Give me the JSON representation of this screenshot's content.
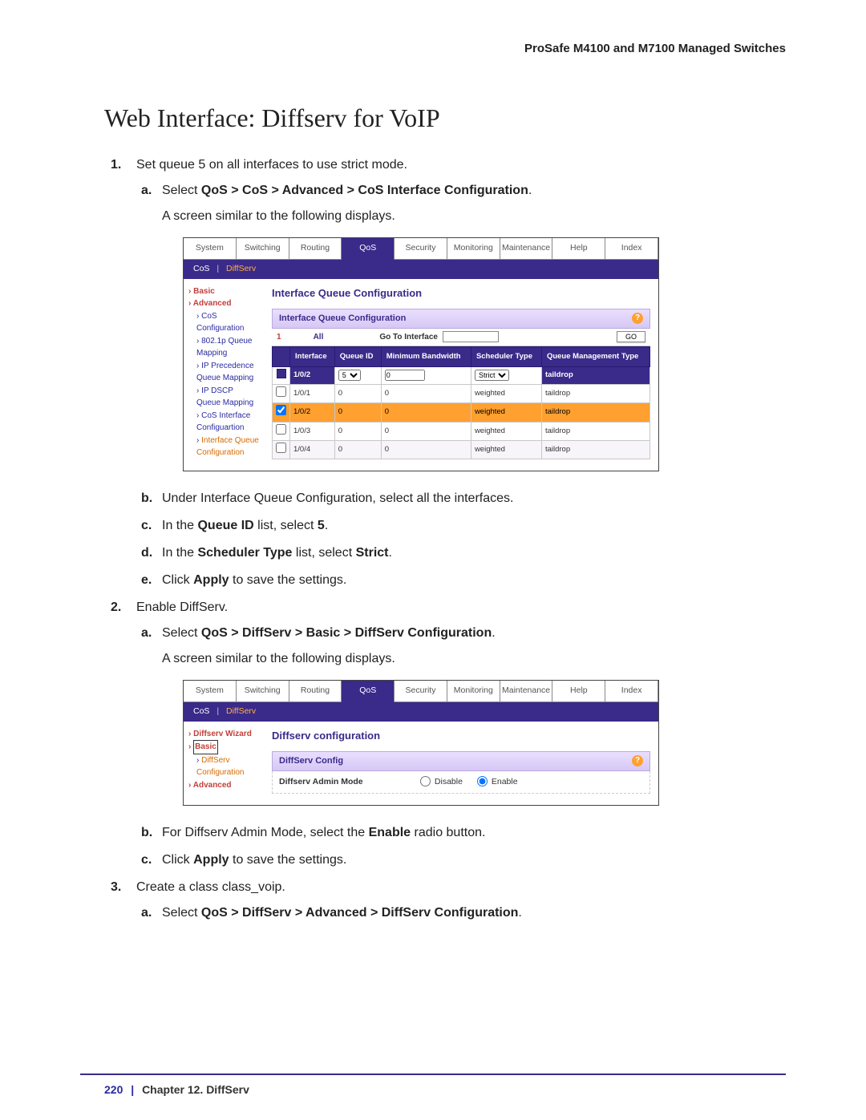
{
  "doc_header": "ProSafe M4100 and M7100 Managed Switches",
  "page_title": "Web Interface: Diffserv for VoIP",
  "steps": {
    "s1": {
      "num": "1.",
      "text": "Set queue 5 on all interfaces to use strict mode.",
      "a_num": "a.",
      "a_pre": "Select ",
      "a_bold": "QoS > CoS > Advanced > CoS Interface Configuration",
      "a_post": ".",
      "a_after": "A screen similar to the following displays.",
      "b_num": "b.",
      "b_text": "Under Interface Queue Configuration, select all the interfaces.",
      "c_num": "c.",
      "c_pre": "In the ",
      "c_bold": "Queue ID",
      "c_mid": " list, select ",
      "c_bold2": "5",
      "c_post": ".",
      "d_num": "d.",
      "d_pre": "In the ",
      "d_bold": "Scheduler Type",
      "d_mid": " list, select ",
      "d_bold2": "Strict",
      "d_post": ".",
      "e_num": "e.",
      "e_pre": "Click ",
      "e_bold": "Apply",
      "e_post": " to save the settings."
    },
    "s2": {
      "num": "2.",
      "text": "Enable DiffServ.",
      "a_num": "a.",
      "a_pre": "Select ",
      "a_bold": "QoS > DiffServ > Basic > DiffServ Configuration",
      "a_post": ".",
      "a_after": "A screen similar to the following displays.",
      "b_num": "b.",
      "b_pre": "For Diffserv Admin Mode, select the ",
      "b_bold": "Enable",
      "b_post": " radio button.",
      "c_num": "c.",
      "c_pre": "Click ",
      "c_bold": "Apply",
      "c_post": " to save the settings."
    },
    "s3": {
      "num": "3.",
      "text": "Create a class class_voip.",
      "a_num": "a.",
      "a_pre": "Select ",
      "a_bold": "QoS > DiffServ > Advanced > DiffServ Configuration",
      "a_post": "."
    }
  },
  "tabs": [
    "System",
    "Switching",
    "Routing",
    "QoS",
    "Security",
    "Monitoring",
    "Maintenance",
    "Help",
    "Index"
  ],
  "subtabs_shot1": {
    "cos": "CoS",
    "diff": "DiffServ"
  },
  "subtabs_shot2": {
    "cos": "CoS",
    "diff": "DiffServ"
  },
  "shot1": {
    "side": {
      "basic": "Basic",
      "advanced": "Advanced",
      "items": [
        "CoS Configuration",
        "802.1p Queue Mapping",
        "IP Precedence Queue Mapping",
        "IP DSCP Queue Mapping",
        "CoS Interface Configuartion",
        "Interface Queue Configuration"
      ]
    },
    "panel_title": "Interface Queue Configuration",
    "panel_sub": "Interface Queue Configuration",
    "gorow": {
      "page": "1",
      "all": "All",
      "goto": "Go To Interface",
      "btn": "GO"
    },
    "headers": [
      "",
      "Interface",
      "Queue ID",
      "Minimum Bandwidth",
      "Scheduler Type",
      "Queue Management Type"
    ],
    "rows": [
      {
        "chk": true,
        "hl": false,
        "if": "1/0/2",
        "q": "5",
        "qsel": true,
        "bw": "0",
        "sched": "Strict",
        "schedsel": true,
        "qm": "taildrop"
      },
      {
        "chk": false,
        "hl": false,
        "if": "1/0/1",
        "q": "0",
        "bw": "0",
        "sched": "weighted",
        "qm": "taildrop"
      },
      {
        "chk": true,
        "hl": true,
        "if": "1/0/2",
        "q": "0",
        "bw": "0",
        "sched": "weighted",
        "qm": "taildrop"
      },
      {
        "chk": false,
        "hl": false,
        "if": "1/0/3",
        "q": "0",
        "bw": "0",
        "sched": "weighted",
        "qm": "taildrop"
      },
      {
        "chk": false,
        "hl": false,
        "alt": true,
        "if": "1/0/4",
        "q": "0",
        "bw": "0",
        "sched": "weighted",
        "qm": "taildrop"
      }
    ]
  },
  "shot2": {
    "side": {
      "wizard": "Diffserv Wizard",
      "basic": "Basic",
      "item": "DiffServ Configuration",
      "advanced": "Advanced"
    },
    "panel_title": "Diffserv configuration",
    "panel_sub": "DiffServ Config",
    "cfg_lbl": "Diffserv Admin Mode",
    "opt_disable": "Disable",
    "opt_enable": "Enable"
  },
  "footer": {
    "page": "220",
    "chapter": "Chapter 12.  DiffServ"
  }
}
